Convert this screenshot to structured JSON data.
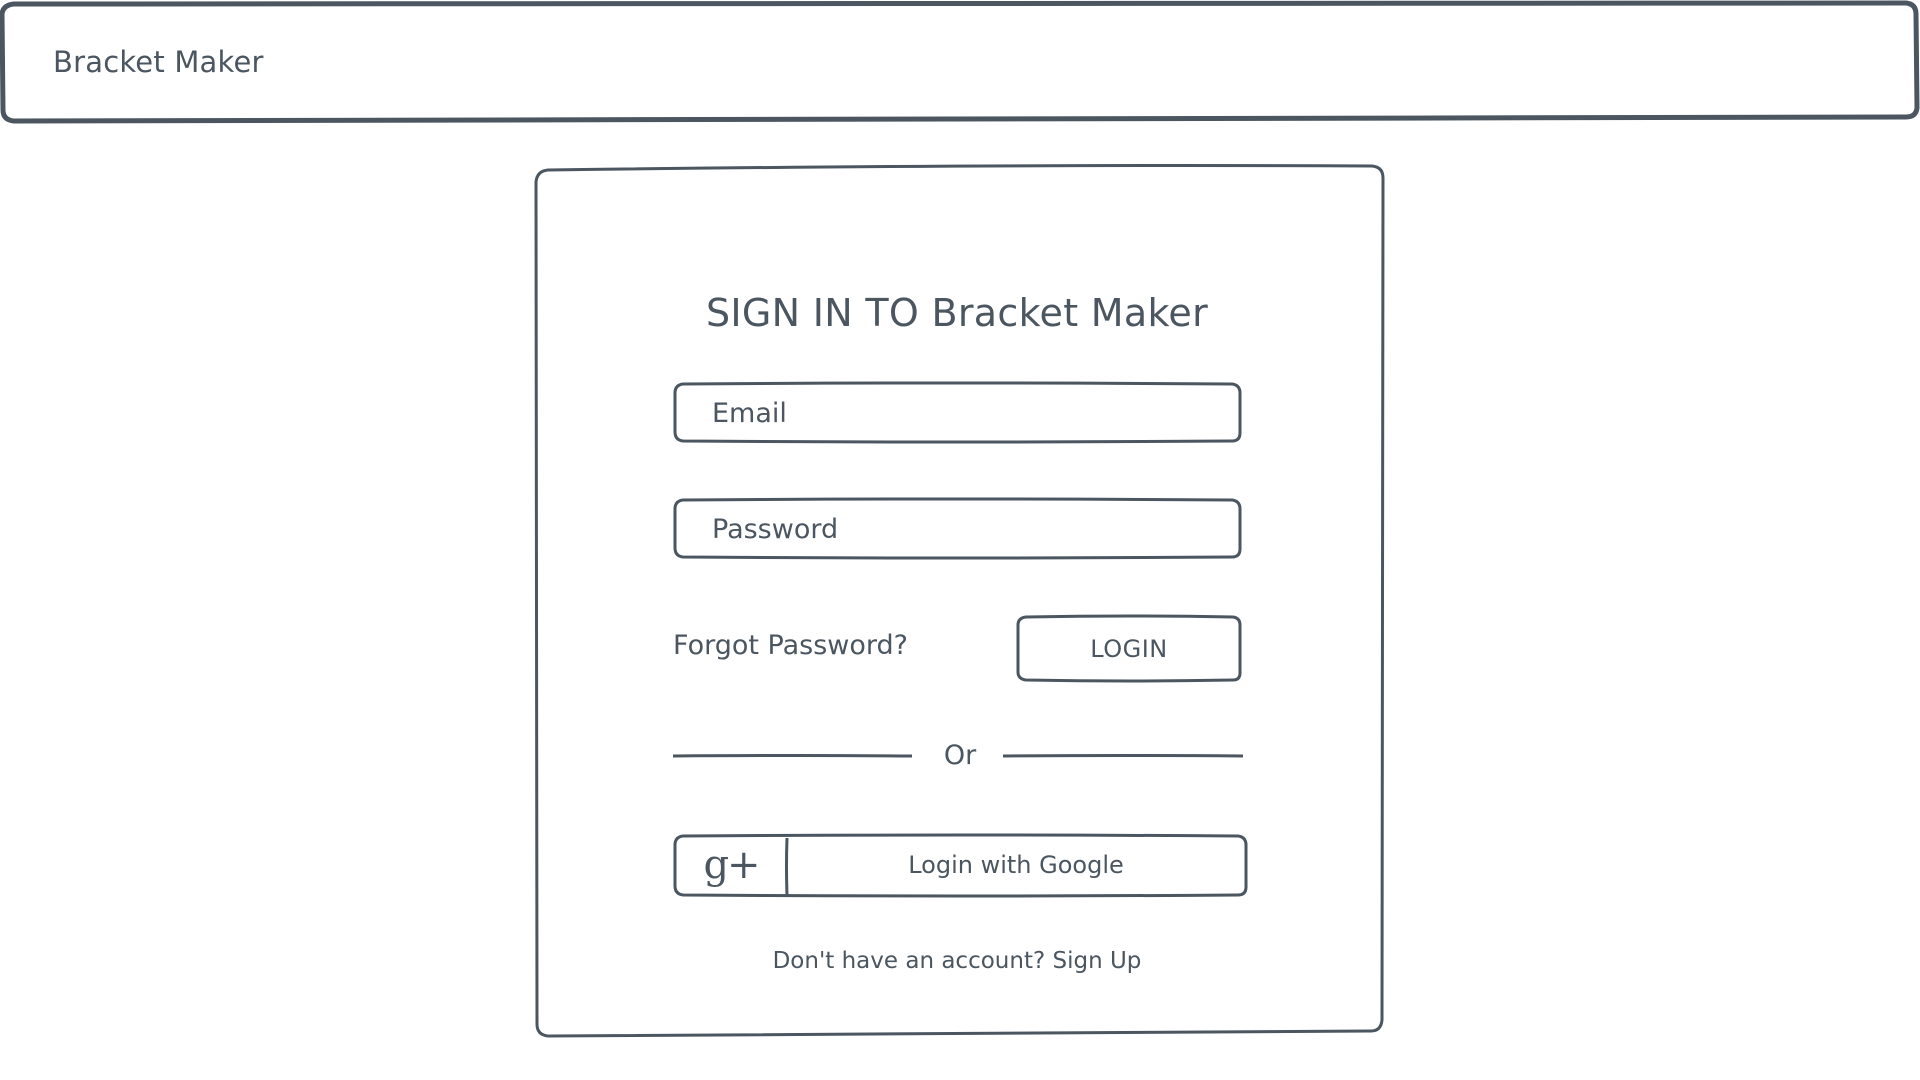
{
  "app": {
    "brand": "Bracket Maker"
  },
  "signin": {
    "title": "SIGN IN TO Bracket Maker",
    "email_placeholder": "Email",
    "password_placeholder": "Password",
    "forgot_password": "Forgot Password?",
    "login_label": "LOGIN",
    "divider_text": "Or",
    "google_icon": "g+",
    "google_label": "Login with Google",
    "signup_prompt": "Don't have an account?",
    "signup_link": "Sign Up"
  },
  "icons": {
    "google": "google-plus-icon"
  },
  "colors": {
    "ink": "#4b5660",
    "background": "#ffffff"
  }
}
